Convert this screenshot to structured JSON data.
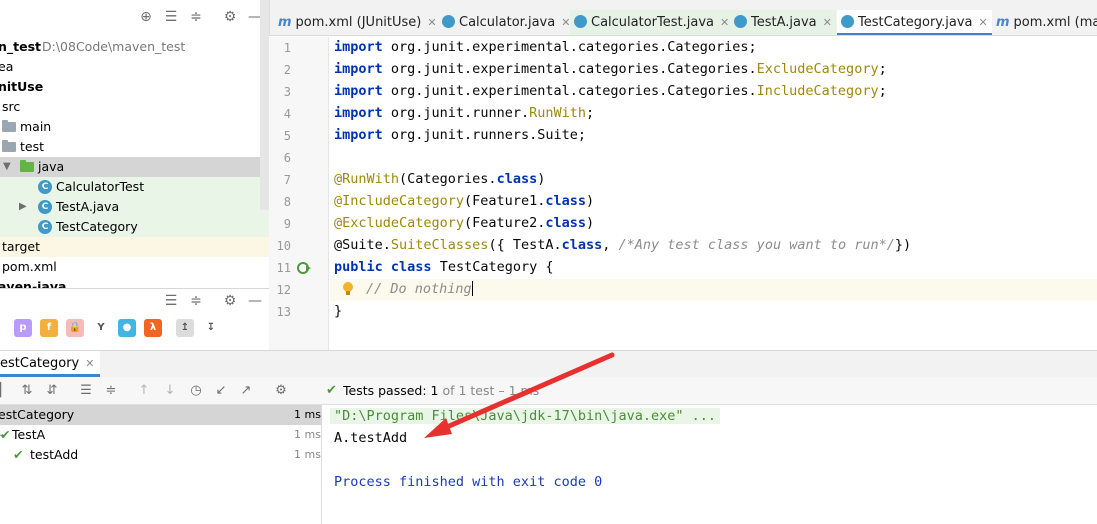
{
  "project_tree": {
    "project_name": "n_test",
    "project_path": "D:\\08Code\\maven_test",
    "rows": [
      "ea",
      "nitUse",
      "src",
      "main",
      "test",
      "java",
      "CalculatorTest",
      "TestA.java",
      "TestCategory",
      "target",
      "pom.xml",
      "aven-java"
    ]
  },
  "editor": {
    "tabs": [
      {
        "label": "pom.xml (JUnitUse)",
        "icon": "m"
      },
      {
        "label": "Calculator.java",
        "icon": "class"
      },
      {
        "label": "CalculatorTest.java",
        "icon": "test-class"
      },
      {
        "label": "TestA.java",
        "icon": "test-class"
      },
      {
        "label": "TestCategory.java",
        "icon": "test-class"
      },
      {
        "label": "pom.xml (mave",
        "icon": "m"
      }
    ],
    "line_numbers": [
      "1",
      "2",
      "3",
      "4",
      "5",
      "6",
      "7",
      "8",
      "9",
      "10",
      "11",
      "12",
      "13"
    ],
    "code": {
      "l1_kw": "import",
      "l1_rest": " org.junit.experimental.categories.Categories;",
      "l2_kw": "import",
      "l2_rest": " org.junit.experimental.categories.Categories.",
      "l2_cls": "ExcludeCategory",
      "l2_end": ";",
      "l3_kw": "import",
      "l3_rest": " org.junit.experimental.categories.Categories.",
      "l3_cls": "IncludeCategory",
      "l3_end": ";",
      "l4_kw": "import",
      "l4_rest": " org.junit.runner.",
      "l4_cls": "RunWith",
      "l4_end": ";",
      "l5_kw": "import",
      "l5_rest": " org.junit.runners.Suite;",
      "l7_an": "@RunWith",
      "l7_a": "(Categories.",
      "l7_kw": "class",
      "l7_b": ")",
      "l8_an": "@IncludeCategory",
      "l8_a": "(Feature1.",
      "l8_kw": "class",
      "l8_b": ")",
      "l9_an": "@ExcludeCategory",
      "l9_a": "(Feature2.",
      "l9_kw": "class",
      "l9_b": ")",
      "l10_an1": "@Suite.",
      "l10_an2": "SuiteClasses",
      "l10_a": "({ TestA.",
      "l10_kw": "class",
      "l10_b": ", ",
      "l10_cm": "/*Any test class you want to run*/",
      "l10_c": "})",
      "l11_kw1": "public",
      "l11_kw2": "class",
      "l11_rest": " TestCategory {",
      "l12_cm": "// Do nothing",
      "l13": "}"
    }
  },
  "run": {
    "tab_label": "estCategory",
    "status_prefix": "Tests passed: ",
    "status_count": "1",
    "status_suffix": " of 1 test – 1 ms",
    "tree": [
      {
        "label": "estCategory",
        "time": "1 ms"
      },
      {
        "label": "TestA",
        "time": "1 ms"
      },
      {
        "label": "testAdd",
        "time": "1 ms"
      }
    ],
    "console": [
      "\"D:\\Program Files\\Java\\jdk-17\\bin\\java.exe\" ...",
      "A.testAdd",
      "",
      "Process finished with exit code 0"
    ]
  },
  "colors": {
    "accent": "#4083c9",
    "passed": "#4c9a3a",
    "arrow": "#e8302f"
  }
}
